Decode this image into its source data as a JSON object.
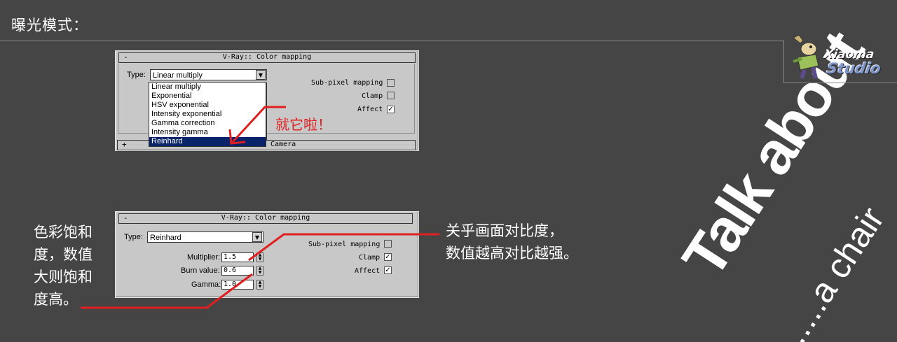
{
  "page_title": "曝光模式：",
  "logo": {
    "line1": "Xiaoma",
    "line2": "Studio"
  },
  "panel_top": {
    "rollout_sign": "-",
    "rollout_title": "V-Ray:: Color mapping",
    "type_label": "Type:",
    "type_value": "Linear multiply",
    "dropdown_options": [
      "Linear multiply",
      "Exponential",
      "HSV exponential",
      "Intensity exponential",
      "Gamma correction",
      "Intensity gamma",
      "Reinhard"
    ],
    "selected_option_index": 6,
    "sub_pixel_label": "Sub-pixel mapping",
    "clamp_label": "Clamp",
    "affect_label": "Affect",
    "bottom_rollout_sign": "+",
    "bottom_rollout_title": "Camera"
  },
  "note_top": "就它啦！",
  "panel_bottom": {
    "rollout_sign": "-",
    "rollout_title": "V-Ray:: Color mapping",
    "type_label": "Type:",
    "type_value": "Reinhard",
    "multiplier_label": "Multiplier:",
    "multiplier_value": "1.5",
    "burn_label": "Burn value:",
    "burn_value": "0.6",
    "gamma_label": "Gamma:",
    "gamma_value": "1.0",
    "sub_pixel_label": "Sub-pixel mapping",
    "clamp_label": "Clamp",
    "affect_label": "Affect"
  },
  "note_left": [
    "色彩饱和",
    "度，数值",
    "大则饱和",
    "度高。"
  ],
  "note_right": [
    "关乎画面对比度，",
    "数值越高对比越强。"
  ],
  "deco": {
    "line1": "Talk about",
    "line2": ".....a chair"
  },
  "colors": {
    "background": "#454545",
    "red": "#e02020",
    "selection": "#0a246a"
  }
}
